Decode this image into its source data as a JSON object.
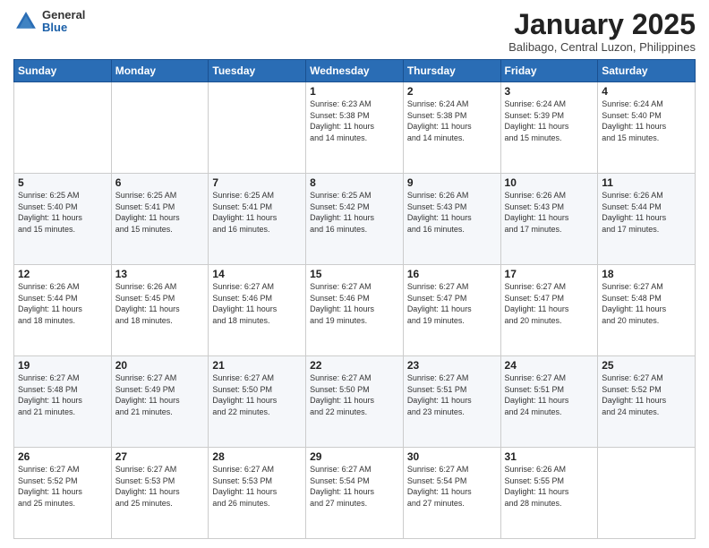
{
  "header": {
    "logo_general": "General",
    "logo_blue": "Blue",
    "month_title": "January 2025",
    "subtitle": "Balibago, Central Luzon, Philippines"
  },
  "weekdays": [
    "Sunday",
    "Monday",
    "Tuesday",
    "Wednesday",
    "Thursday",
    "Friday",
    "Saturday"
  ],
  "weeks": [
    [
      {
        "day": "",
        "info": ""
      },
      {
        "day": "",
        "info": ""
      },
      {
        "day": "",
        "info": ""
      },
      {
        "day": "1",
        "info": "Sunrise: 6:23 AM\nSunset: 5:38 PM\nDaylight: 11 hours\nand 14 minutes."
      },
      {
        "day": "2",
        "info": "Sunrise: 6:24 AM\nSunset: 5:38 PM\nDaylight: 11 hours\nand 14 minutes."
      },
      {
        "day": "3",
        "info": "Sunrise: 6:24 AM\nSunset: 5:39 PM\nDaylight: 11 hours\nand 15 minutes."
      },
      {
        "day": "4",
        "info": "Sunrise: 6:24 AM\nSunset: 5:40 PM\nDaylight: 11 hours\nand 15 minutes."
      }
    ],
    [
      {
        "day": "5",
        "info": "Sunrise: 6:25 AM\nSunset: 5:40 PM\nDaylight: 11 hours\nand 15 minutes."
      },
      {
        "day": "6",
        "info": "Sunrise: 6:25 AM\nSunset: 5:41 PM\nDaylight: 11 hours\nand 15 minutes."
      },
      {
        "day": "7",
        "info": "Sunrise: 6:25 AM\nSunset: 5:41 PM\nDaylight: 11 hours\nand 16 minutes."
      },
      {
        "day": "8",
        "info": "Sunrise: 6:25 AM\nSunset: 5:42 PM\nDaylight: 11 hours\nand 16 minutes."
      },
      {
        "day": "9",
        "info": "Sunrise: 6:26 AM\nSunset: 5:43 PM\nDaylight: 11 hours\nand 16 minutes."
      },
      {
        "day": "10",
        "info": "Sunrise: 6:26 AM\nSunset: 5:43 PM\nDaylight: 11 hours\nand 17 minutes."
      },
      {
        "day": "11",
        "info": "Sunrise: 6:26 AM\nSunset: 5:44 PM\nDaylight: 11 hours\nand 17 minutes."
      }
    ],
    [
      {
        "day": "12",
        "info": "Sunrise: 6:26 AM\nSunset: 5:44 PM\nDaylight: 11 hours\nand 18 minutes."
      },
      {
        "day": "13",
        "info": "Sunrise: 6:26 AM\nSunset: 5:45 PM\nDaylight: 11 hours\nand 18 minutes."
      },
      {
        "day": "14",
        "info": "Sunrise: 6:27 AM\nSunset: 5:46 PM\nDaylight: 11 hours\nand 18 minutes."
      },
      {
        "day": "15",
        "info": "Sunrise: 6:27 AM\nSunset: 5:46 PM\nDaylight: 11 hours\nand 19 minutes."
      },
      {
        "day": "16",
        "info": "Sunrise: 6:27 AM\nSunset: 5:47 PM\nDaylight: 11 hours\nand 19 minutes."
      },
      {
        "day": "17",
        "info": "Sunrise: 6:27 AM\nSunset: 5:47 PM\nDaylight: 11 hours\nand 20 minutes."
      },
      {
        "day": "18",
        "info": "Sunrise: 6:27 AM\nSunset: 5:48 PM\nDaylight: 11 hours\nand 20 minutes."
      }
    ],
    [
      {
        "day": "19",
        "info": "Sunrise: 6:27 AM\nSunset: 5:48 PM\nDaylight: 11 hours\nand 21 minutes."
      },
      {
        "day": "20",
        "info": "Sunrise: 6:27 AM\nSunset: 5:49 PM\nDaylight: 11 hours\nand 21 minutes."
      },
      {
        "day": "21",
        "info": "Sunrise: 6:27 AM\nSunset: 5:50 PM\nDaylight: 11 hours\nand 22 minutes."
      },
      {
        "day": "22",
        "info": "Sunrise: 6:27 AM\nSunset: 5:50 PM\nDaylight: 11 hours\nand 22 minutes."
      },
      {
        "day": "23",
        "info": "Sunrise: 6:27 AM\nSunset: 5:51 PM\nDaylight: 11 hours\nand 23 minutes."
      },
      {
        "day": "24",
        "info": "Sunrise: 6:27 AM\nSunset: 5:51 PM\nDaylight: 11 hours\nand 24 minutes."
      },
      {
        "day": "25",
        "info": "Sunrise: 6:27 AM\nSunset: 5:52 PM\nDaylight: 11 hours\nand 24 minutes."
      }
    ],
    [
      {
        "day": "26",
        "info": "Sunrise: 6:27 AM\nSunset: 5:52 PM\nDaylight: 11 hours\nand 25 minutes."
      },
      {
        "day": "27",
        "info": "Sunrise: 6:27 AM\nSunset: 5:53 PM\nDaylight: 11 hours\nand 25 minutes."
      },
      {
        "day": "28",
        "info": "Sunrise: 6:27 AM\nSunset: 5:53 PM\nDaylight: 11 hours\nand 26 minutes."
      },
      {
        "day": "29",
        "info": "Sunrise: 6:27 AM\nSunset: 5:54 PM\nDaylight: 11 hours\nand 27 minutes."
      },
      {
        "day": "30",
        "info": "Sunrise: 6:27 AM\nSunset: 5:54 PM\nDaylight: 11 hours\nand 27 minutes."
      },
      {
        "day": "31",
        "info": "Sunrise: 6:26 AM\nSunset: 5:55 PM\nDaylight: 11 hours\nand 28 minutes."
      },
      {
        "day": "",
        "info": ""
      }
    ]
  ]
}
